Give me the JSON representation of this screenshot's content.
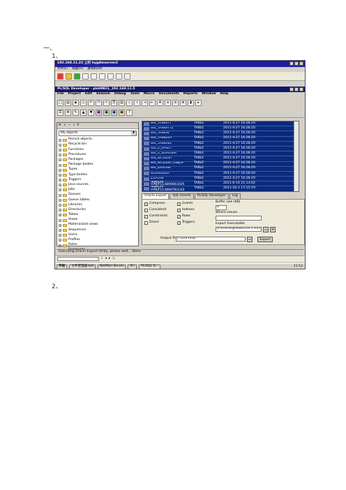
{
  "doc": {
    "heading1": "一、",
    "heading2": "1、",
    "heading3": "2、"
  },
  "remote": {
    "title": "192.168.11.23 上的 hygdmserver2",
    "menu": [
      "文件(F)",
      "视图(V)",
      "虚拟机(M)"
    ]
  },
  "app": {
    "title": "PL/SQL Developer - plsH0ECL_192.168.11.5",
    "menu": [
      "File",
      "Project",
      "Edit",
      "Session",
      "Debug",
      "Tools",
      "Macro",
      "Documents",
      "Reports",
      "Window",
      "Help"
    ]
  },
  "browser": {
    "selector": "My objects",
    "tree": [
      "Recent objects",
      "Recycle bin",
      "Functions",
      "Procedures",
      "Packages",
      "Package bodies",
      "Types",
      "Type bodies",
      "Triggers",
      "Java sources",
      "Jobs",
      "Queues",
      "Queue tables",
      "Libraries",
      "Directories",
      "Tables",
      "Views",
      "Materialized views",
      "Sequences",
      "Users",
      "Profiles",
      "Roles",
      "Synonyms"
    ]
  },
  "objects": [
    {
      "name": "WK_TASKATT",
      "type": "TABLE",
      "date": "2011-4-27 16:28:20"
    },
    {
      "name": "WK_TASKATT2",
      "type": "TABLE",
      "date": "2011-4-27 16:28:20"
    },
    {
      "name": "WK_TASKIN",
      "type": "TABLE",
      "date": "2011-4-27 16:28:20"
    },
    {
      "name": "WK_TASKOUT",
      "type": "TABLE",
      "date": "2011-4-27 16:28:20"
    },
    {
      "name": "WK_TASKREL",
      "type": "TABLE",
      "date": "2011-4-27 16:28:20"
    },
    {
      "name": "WK_V_APART",
      "type": "TABLE",
      "date": "2011-4-27 16:28:20"
    },
    {
      "name": "WK_V_SUPPLIER",
      "type": "TABLE",
      "date": "2011-4-27 16:28:20"
    },
    {
      "name": "WK_WCLIENT",
      "type": "TABLE",
      "date": "2011-4-27 16:28:20"
    },
    {
      "name": "WK_WCLIENT_OBJOF",
      "type": "TABLE",
      "date": "2011-4-27 16:28:20"
    },
    {
      "name": "WK_ZHPLAN",
      "type": "TABLE",
      "date": "2011-4-27 16:28:20"
    },
    {
      "name": "WORKAREA",
      "type": "TABLE",
      "date": "2011-4-27 16:28:20"
    },
    {
      "name": "ZXPLAN",
      "type": "TABLE",
      "date": "2011-4-27 16:28:20"
    },
    {
      "name": "本期结构HP8/F11380084/20/5",
      "type": "TABLE",
      "date": "2011-6-14 21:13:02"
    },
    {
      "name": "本期结构HP8/F11380678/23/2",
      "type": "TABLE",
      "date": "2011-10-1 17:15:19"
    }
  ],
  "tabs": [
    "Oracle Export",
    "SQL Inserts",
    "PL/SQL Developer",
    "Log"
  ],
  "options": {
    "col1": [
      {
        "label": "Compress",
        "checked": true
      },
      {
        "label": "Consistent",
        "checked": false
      },
      {
        "label": "Constraints",
        "checked": true
      },
      {
        "label": "Direct",
        "checked": false
      }
    ],
    "col2": [
      {
        "label": "Grants",
        "checked": true
      },
      {
        "label": "Indexes",
        "checked": true
      },
      {
        "label": "Rows",
        "checked": true
      },
      {
        "label": "Triggers",
        "checked": true
      }
    ],
    "buffer_label": "Buffer size (KB)",
    "buffer_value": "4",
    "where_label": "Where clause",
    "exe_label": "Export Executable",
    "exe_value": "d:\\Oracle\\product\\10.1.0\\Clie",
    "output_label": "Output file",
    "output_value": "c:\\123.dmp",
    "export_button": "Export"
  },
  "status": "Executing Oracle Export Utility, please wait...    Done",
  "taskbar": {
    "start": "开始",
    "items": [
      "文件管理器 bat",
      "NetMan Server",
      "D:\\",
      "PL/SQL D..."
    ],
    "clock": "11:12"
  }
}
